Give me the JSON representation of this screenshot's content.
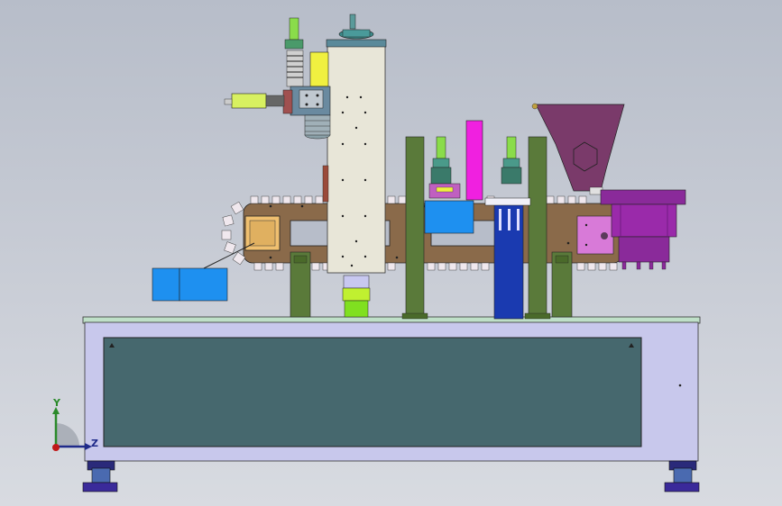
{
  "view": {
    "background_top": "#b7bdc9",
    "background_bottom": "#d8dbe1"
  },
  "triad": {
    "y_axis_label": "Y",
    "z_axis_label": "Z",
    "y_color": "#2a8a2a",
    "z_color": "#1f2a8a",
    "origin_color": "#c01818"
  },
  "colors": {
    "base_frame": "#c8c8ec",
    "base_panel": "#46686e",
    "base_top_plate": "#bfe0c8",
    "conveyor_plate": "#8a6a4a",
    "conveyor_links": "#f0e8ee",
    "center_column": "#e8e6d8",
    "green_posts": "#5a7a3a",
    "blue_blocks": "#1e90f0",
    "dark_blue_post": "#1a3ab0",
    "hopper": "#7a3a6a",
    "bowl": "#8a2a9a",
    "pink_bar": "#f020e0",
    "pink_plate": "#d87ad8",
    "yellow_block": "#f0f040",
    "feet": "#3a2a9a"
  }
}
